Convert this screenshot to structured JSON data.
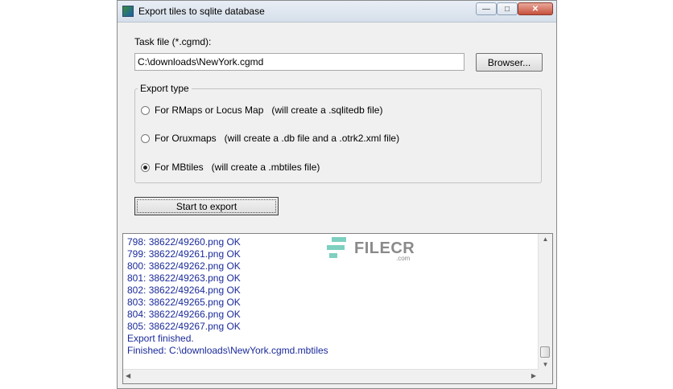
{
  "window": {
    "title": "Export tiles to sqlite database"
  },
  "task_file": {
    "label": "Task file (*.cgmd):",
    "value": "C:\\downloads\\NewYork.cgmd",
    "browse_label": "Browser..."
  },
  "export_type": {
    "legend": "Export type",
    "options": [
      {
        "label": "For RMaps or Locus Map   (will create a .sqlitedb file)",
        "checked": false
      },
      {
        "label": "For Oruxmaps   (will create a .db file and a .otrk2.xml file)",
        "checked": false
      },
      {
        "label": "For MBtiles   (will create a .mbtiles file)",
        "checked": true
      }
    ]
  },
  "start_button": {
    "label": "Start to export"
  },
  "log": {
    "lines": [
      "798: 38622/49260.png OK",
      "799: 38622/49261.png OK",
      "800: 38622/49262.png OK",
      "801: 38622/49263.png OK",
      "802: 38622/49264.png OK",
      "803: 38622/49265.png OK",
      "804: 38622/49266.png OK",
      "805: 38622/49267.png OK",
      "Export finished.",
      "Finished: C:\\downloads\\NewYork.cgmd.mbtiles"
    ]
  },
  "watermark": {
    "name": "FILECR",
    "domain": ".com"
  },
  "colors": {
    "log_text": "#1a2a9a",
    "watermark_accent": "#7ed0c0"
  },
  "icons": {
    "app": "app-icon",
    "minimize": "minimize-icon",
    "maximize": "maximize-icon",
    "close": "close-icon"
  }
}
